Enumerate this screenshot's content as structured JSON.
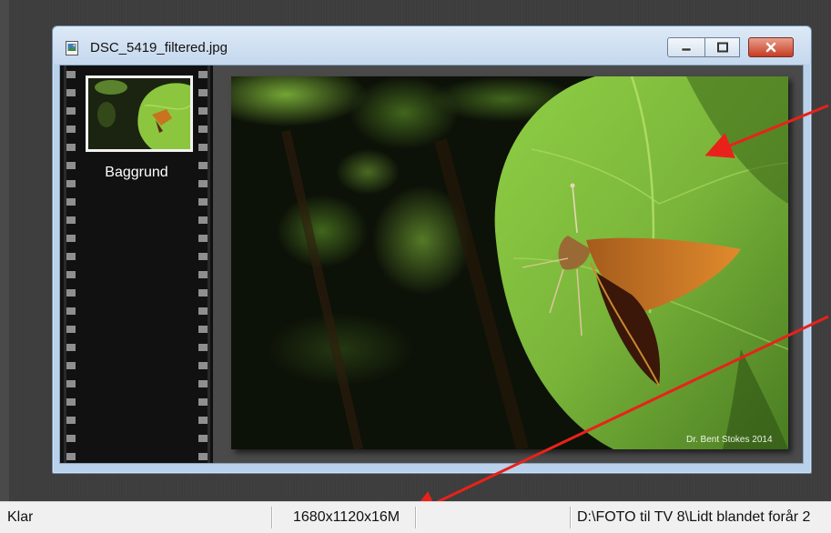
{
  "window": {
    "title": "DSC_5419_filtered.jpg",
    "buttons": {
      "minimize": "minimize",
      "maximize": "maximize",
      "close": "close"
    }
  },
  "filmstrip": {
    "items": [
      {
        "label": "Baggrund"
      }
    ]
  },
  "photo": {
    "subject": "butterfly on leaf",
    "watermark": "Dr. Bent Stokes 2014"
  },
  "statusbar": {
    "status": "Klar",
    "image_info": "1680x1120x16M",
    "file_path": "D:\\FOTO til TV 8\\Lidt blandet forår 2"
  },
  "annotations": {
    "arrow_color": "#e8221a"
  }
}
